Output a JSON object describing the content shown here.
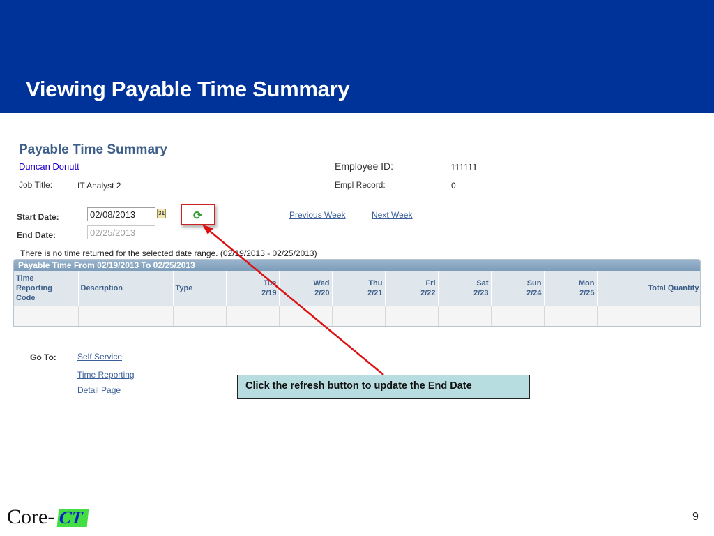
{
  "slide": {
    "title": "Viewing Payable Time Summary",
    "page_number": "9",
    "logo_text": "Core-",
    "logo_accent": "CT",
    "callout_text": "Click the refresh button to update the End Date",
    "colors": {
      "banner": "#003399",
      "callout": "#b8dde0",
      "arrow": "#dd1111"
    }
  },
  "page": {
    "title": "Payable Time Summary",
    "employee_name": "Duncan Donutt",
    "job_title_label": "Job Title:",
    "job_title_value": "IT Analyst 2",
    "employee_id_label": "Employee ID:",
    "employee_id_value": "111111",
    "empl_record_label": "Empl Record:",
    "empl_record_value": "0",
    "start_date_label": "Start Date:",
    "start_date_value": "02/08/2013",
    "end_date_label": "End Date:",
    "end_date_value": "02/25/2013",
    "calendar_icon_text": "31",
    "refresh_icon": "refresh-icon",
    "previous_week": "Previous Week",
    "next_week": "Next Week",
    "message": "There is no time returned for the selected date range. (02/19/2013 - 02/25/2013)"
  },
  "grid": {
    "title": "Payable Time From 02/19/2013 To 02/25/2013",
    "columns": [
      {
        "line1": "Time",
        "line2": "Reporting",
        "line3": "Code"
      },
      {
        "line1": "Description"
      },
      {
        "line1": "Type"
      },
      {
        "line1": "Tue",
        "line2": "2/19"
      },
      {
        "line1": "Wed",
        "line2": "2/20"
      },
      {
        "line1": "Thu",
        "line2": "2/21"
      },
      {
        "line1": "Fri",
        "line2": "2/22"
      },
      {
        "line1": "Sat",
        "line2": "2/23"
      },
      {
        "line1": "Sun",
        "line2": "2/24"
      },
      {
        "line1": "Mon",
        "line2": "2/25"
      },
      {
        "line1": "Total Quantity"
      }
    ],
    "rows": [
      [
        "",
        "",
        "",
        "",
        "",
        "",
        "",
        "",
        "",
        "",
        ""
      ]
    ]
  },
  "goto": {
    "label": "Go To:",
    "links": [
      "Self Service",
      "Time Reporting",
      "Detail Page"
    ]
  }
}
